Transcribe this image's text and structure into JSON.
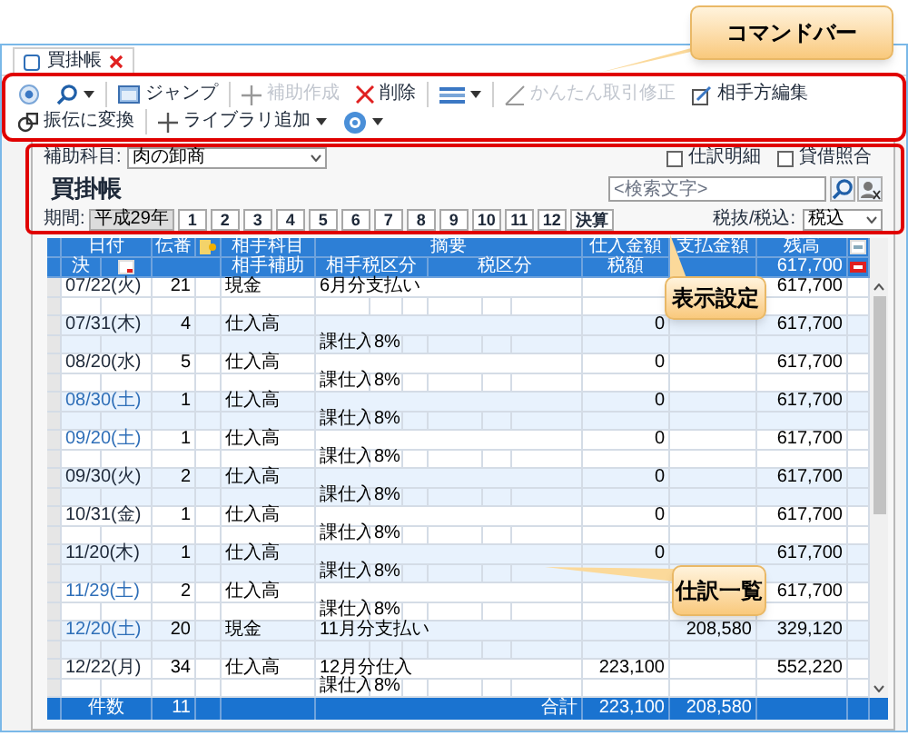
{
  "callouts": [
    "コマンドバー",
    "表示設定",
    "仕訳一覧"
  ],
  "tab": {
    "label": "買掛帳"
  },
  "toolbar": [
    {
      "disabled": false,
      "dropdown": false
    },
    {
      "disabled": false,
      "dropdown": true
    },
    {
      "label": "ジャンプ",
      "disabled": false,
      "dropdown": false
    },
    {
      "label": "補助作成",
      "disabled": true,
      "dropdown": false
    },
    {
      "label": "削除",
      "disabled": false,
      "dropdown": false
    },
    {
      "disabled": false,
      "dropdown": true
    },
    {
      "label": "かんたん取引修正",
      "disabled": true,
      "dropdown": false
    },
    {
      "label": "相手方編集",
      "disabled": false,
      "dropdown": false
    },
    {
      "label": "振伝に変換",
      "disabled": false,
      "dropdown": false
    },
    {
      "label": "ライブラリ追加",
      "disabled": false,
      "dropdown": true
    },
    {
      "disabled": false,
      "dropdown": true
    }
  ],
  "filter": {
    "sub_account": {
      "label": "補助科目:",
      "value": "肉の卸商"
    },
    "options": [
      {
        "label": "仕訳明細",
        "checked": false
      },
      {
        "label": "貸借照合",
        "checked": false
      }
    ],
    "title": "買掛帳",
    "search": {
      "placeholder": "<検索文字>"
    },
    "period": {
      "label": "期間:",
      "era": "平成29年",
      "months": [
        "1",
        "2",
        "3",
        "4",
        "5",
        "6",
        "7",
        "8",
        "9",
        "10",
        "11",
        "12",
        "決算"
      ]
    },
    "tax_mode": {
      "label": "税抜/税込:",
      "value": "税込"
    }
  },
  "table": {
    "header": {
      "row1": [
        "日付",
        "伝番",
        "相手科目",
        "摘要",
        "仕入金額",
        "支払金額",
        "残高"
      ],
      "row2": [
        "決",
        "相手補助",
        "相手税区分",
        "税区分",
        "税額"
      ],
      "carry_balance": "617,700"
    },
    "rows": [
      {
        "date": "07/22(火)",
        "weekend": false,
        "no": "21",
        "account": "現金",
        "memo": "6月分支払い",
        "balance": "617,700"
      },
      {
        "date": "07/31(木)",
        "weekend": false,
        "no": "4",
        "account": "仕入高",
        "purchase": "0",
        "balance": "617,700",
        "tax_category": "課仕入",
        "tax_rate": "8%"
      },
      {
        "date": "08/20(水)",
        "weekend": false,
        "no": "5",
        "account": "仕入高",
        "purchase": "0",
        "balance": "617,700",
        "tax_category": "課仕入",
        "tax_rate": "8%"
      },
      {
        "date": "08/30(土)",
        "weekend": true,
        "no": "1",
        "account": "仕入高",
        "purchase": "0",
        "balance": "617,700",
        "tax_category": "課仕入",
        "tax_rate": "8%"
      },
      {
        "date": "09/20(土)",
        "weekend": true,
        "no": "1",
        "account": "仕入高",
        "purchase": "0",
        "balance": "617,700",
        "tax_category": "課仕入",
        "tax_rate": "8%"
      },
      {
        "date": "09/30(火)",
        "weekend": false,
        "no": "2",
        "account": "仕入高",
        "purchase": "0",
        "balance": "617,700",
        "tax_category": "課仕入",
        "tax_rate": "8%"
      },
      {
        "date": "10/31(金)",
        "weekend": false,
        "no": "1",
        "account": "仕入高",
        "purchase": "0",
        "balance": "617,700",
        "tax_category": "課仕入",
        "tax_rate": "8%"
      },
      {
        "date": "11/20(木)",
        "weekend": false,
        "no": "1",
        "account": "仕入高",
        "purchase": "0",
        "balance": "617,700",
        "tax_category": "課仕入",
        "tax_rate": "8%"
      },
      {
        "date": "11/29(土)",
        "weekend": true,
        "no": "2",
        "account": "仕入高",
        "balance": "617,700",
        "tax_category": "課仕入",
        "tax_rate": "8%"
      },
      {
        "date": "12/20(土)",
        "weekend": true,
        "no": "20",
        "account": "現金",
        "memo": "11月分支払い",
        "payment": "208,580",
        "balance": "329,120"
      },
      {
        "date": "12/22(月)",
        "weekend": false,
        "no": "34",
        "account": "仕入高",
        "memo": "12月分仕入",
        "purchase": "223,100",
        "balance": "552,220",
        "tax_category": "課仕入",
        "tax_rate": "8%"
      }
    ],
    "footer": {
      "count_label": "件数",
      "count": "11",
      "total_label": "合計",
      "purchase_total": "223,100",
      "payment_total": "208,580"
    }
  }
}
